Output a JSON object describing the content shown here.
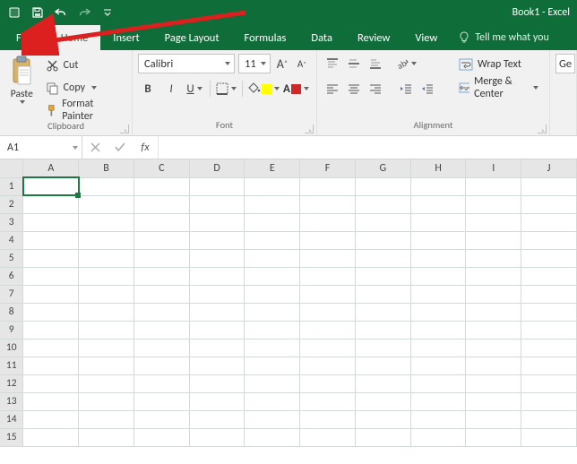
{
  "title": "Book1 - Excel",
  "tabs": {
    "file": "File",
    "home": "Home",
    "insert": "Insert",
    "pagelayout": "Page Layout",
    "formulas": "Formulas",
    "data": "Data",
    "review": "Review",
    "view": "View",
    "tellme": "Tell me what you"
  },
  "clipboard": {
    "paste": "Paste",
    "cut": "Cut",
    "copy": "Copy",
    "formatpainter": "Format Painter",
    "label": "Clipboard"
  },
  "font": {
    "name": "Calibri",
    "size": "11",
    "grow": "A",
    "shrink": "A",
    "bold": "B",
    "italic": "I",
    "underline": "U",
    "label": "Font"
  },
  "alignment": {
    "wrap": "Wrap Text",
    "merge": "Merge & Center",
    "label": "Alignment"
  },
  "extra": {
    "ge": "Ge"
  },
  "namebox": "A1",
  "fx": "fx",
  "columns": [
    "A",
    "B",
    "C",
    "D",
    "E",
    "F",
    "G",
    "H",
    "I",
    "J"
  ],
  "rows": [
    "1",
    "2",
    "3",
    "4",
    "5",
    "6",
    "7",
    "8",
    "9",
    "10",
    "11",
    "12",
    "13",
    "14",
    "15"
  ]
}
